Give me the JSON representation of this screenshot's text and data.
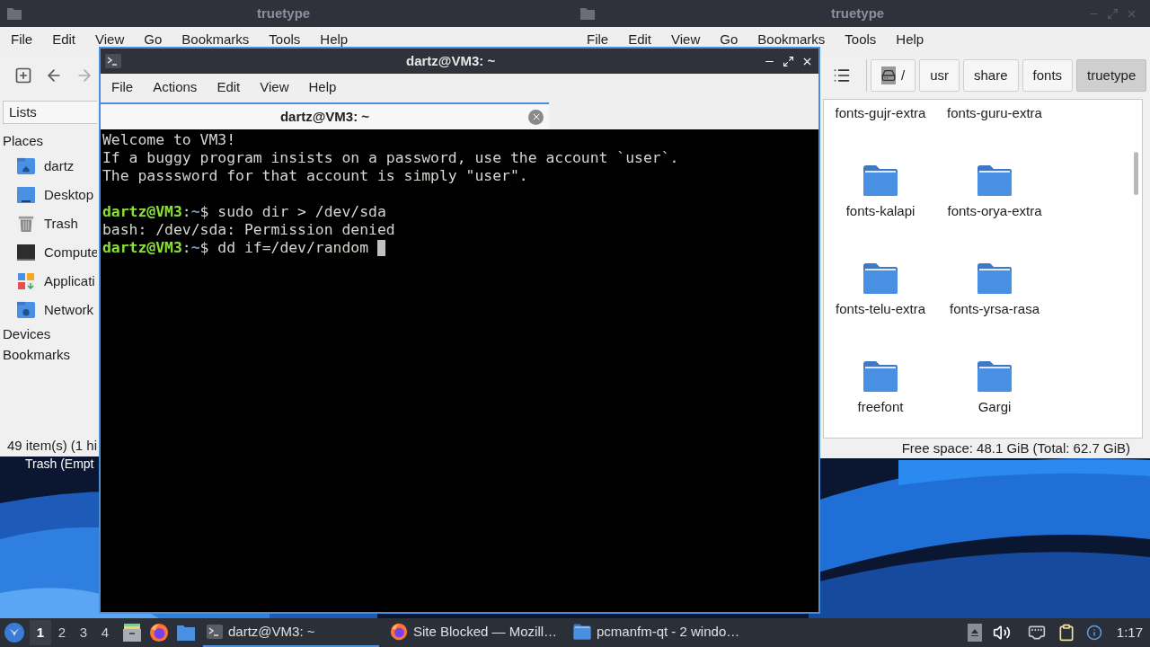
{
  "left_window": {
    "title": "truetype",
    "menu": [
      "File",
      "Edit",
      "View",
      "Go",
      "Bookmarks",
      "Tools",
      "Help"
    ],
    "sidebar": {
      "selector": "Lists",
      "sections": [
        {
          "label": "Places",
          "items": [
            {
              "label": "dartz",
              "kind": "home"
            },
            {
              "label": "Desktop",
              "kind": "desktop"
            },
            {
              "label": "Trash",
              "kind": "trash"
            },
            {
              "label": "Compute",
              "kind": "computer"
            },
            {
              "label": "Applicati",
              "kind": "apps"
            },
            {
              "label": "Network",
              "kind": "network"
            }
          ]
        },
        {
          "label": "Devices"
        },
        {
          "label": "Bookmarks"
        }
      ]
    },
    "status": "49 item(s) (1 hi"
  },
  "desktop": {
    "icons": [
      {
        "label": "Trash (Empt"
      }
    ]
  },
  "right_window": {
    "title": "truetype",
    "menu": [
      "File",
      "Edit",
      "View",
      "Go",
      "Bookmarks",
      "Tools",
      "Help"
    ],
    "path": [
      {
        "label": "/",
        "kind": "root",
        "selected": false
      },
      {
        "label": "usr",
        "kind": "dir",
        "selected": false
      },
      {
        "label": "share",
        "kind": "dir",
        "selected": false
      },
      {
        "label": "fonts",
        "kind": "dir",
        "selected": false
      },
      {
        "label": "truetype",
        "kind": "dir",
        "selected": true
      }
    ],
    "rows": [
      [
        {
          "label": "fonts-gujr-extra",
          "kind": "cut"
        },
        {
          "label": "fonts-guru-extra",
          "kind": "cut"
        }
      ],
      [
        {
          "label": "fonts-kalapi",
          "kind": "folder"
        },
        {
          "label": "fonts-orya-extra",
          "kind": "folder"
        }
      ],
      [
        {
          "label": "fonts-telu-extra",
          "kind": "folder"
        },
        {
          "label": "fonts-yrsa-rasa",
          "kind": "folder"
        }
      ],
      [
        {
          "label": "freefont",
          "kind": "folder"
        },
        {
          "label": "Gargi",
          "kind": "folder"
        }
      ]
    ],
    "status": "Free space: 48.1 GiB (Total: 62.7 GiB)"
  },
  "terminal": {
    "title": "dartz@VM3: ~",
    "menu": [
      "File",
      "Actions",
      "Edit",
      "View",
      "Help"
    ],
    "tabs": [
      {
        "label": "dartz@VM3: ~",
        "selected": true
      }
    ],
    "lines": [
      {
        "kind": "output",
        "text": "Welcome to VM3!"
      },
      {
        "kind": "output",
        "text": "If a buggy program insists on a password, use the account `user`."
      },
      {
        "kind": "output",
        "text": "The passsword for that account is simply \"user\"."
      },
      {
        "kind": "blank"
      },
      {
        "kind": "prompt",
        "user": "dartz@VM3",
        "sep": ":",
        "path": "~",
        "symbol": "$",
        "command": " sudo dir > /dev/sda",
        "cursor": false
      },
      {
        "kind": "output",
        "text": "bash: /dev/sda: Permission denied"
      },
      {
        "kind": "prompt",
        "user": "dartz@VM3",
        "sep": ":",
        "path": "~",
        "symbol": "$",
        "command": " dd if=/dev/random ",
        "cursor": true
      }
    ]
  },
  "taskbar": {
    "workspaces": [
      {
        "label": "1",
        "selected": true
      },
      {
        "label": "2",
        "selected": false
      },
      {
        "label": "3",
        "selected": false
      },
      {
        "label": "4",
        "selected": false
      }
    ],
    "launchers": [
      {
        "kind": "files"
      },
      {
        "kind": "firefox"
      },
      {
        "kind": "folder"
      }
    ],
    "tasks": [
      {
        "label": "dartz@VM3: ~",
        "kind": "terminal",
        "selected": true
      },
      {
        "label": "Site Blocked — Mozill…",
        "kind": "firefox",
        "selected": false
      },
      {
        "label": "pcmanfm-qt - 2 windo…",
        "kind": "folder",
        "selected": false
      }
    ],
    "clock": "1:17"
  }
}
